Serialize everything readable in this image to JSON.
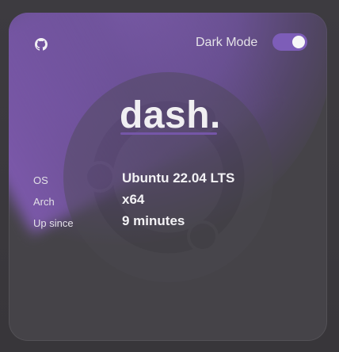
{
  "topbar": {
    "github_icon": "github-icon",
    "dark_mode_label": "Dark Mode",
    "dark_mode_enabled": true
  },
  "brand": {
    "title": "dash."
  },
  "system_info": {
    "rows": [
      {
        "label": "OS",
        "value": "Ubuntu 22.04 LTS"
      },
      {
        "label": "Arch",
        "value": "x64"
      },
      {
        "label": "Up since",
        "value": "9 minutes"
      }
    ]
  },
  "theme": {
    "accent": "#7d5db8",
    "card_background": "#454348",
    "page_background": "#3a383c"
  }
}
